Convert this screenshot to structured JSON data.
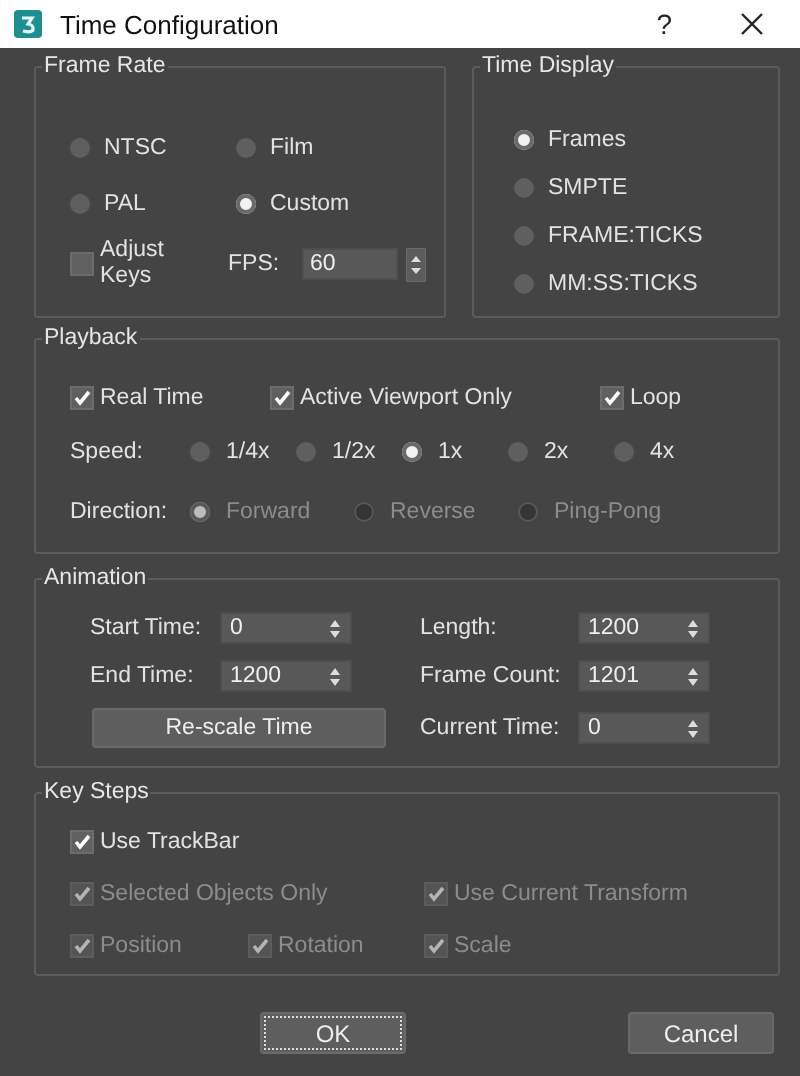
{
  "window": {
    "title": "Time Configuration",
    "help": "?"
  },
  "frame_rate": {
    "title": "Frame Rate",
    "options": [
      {
        "label": "NTSC",
        "selected": false
      },
      {
        "label": "Film",
        "selected": false
      },
      {
        "label": "PAL",
        "selected": false
      },
      {
        "label": "Custom",
        "selected": true
      }
    ],
    "adjust_keys": {
      "label": "Adjust Keys",
      "checked": false
    },
    "fps": {
      "label": "FPS:",
      "value": "60"
    }
  },
  "time_display": {
    "title": "Time Display",
    "options": [
      {
        "label": "Frames",
        "selected": true
      },
      {
        "label": "SMPTE",
        "selected": false
      },
      {
        "label": "FRAME:TICKS",
        "selected": false
      },
      {
        "label": "MM:SS:TICKS",
        "selected": false
      }
    ]
  },
  "playback": {
    "title": "Playback",
    "checks": [
      {
        "label": "Real Time",
        "checked": true
      },
      {
        "label": "Active Viewport Only",
        "checked": true
      },
      {
        "label": "Loop",
        "checked": true
      }
    ],
    "speed": {
      "label": "Speed:",
      "options": [
        {
          "label": "1/4x",
          "selected": false,
          "disabled": false
        },
        {
          "label": "1/2x",
          "selected": false,
          "disabled": false
        },
        {
          "label": "1x",
          "selected": true,
          "disabled": false
        },
        {
          "label": "2x",
          "selected": false,
          "disabled": false
        },
        {
          "label": "4x",
          "selected": false,
          "disabled": false
        }
      ]
    },
    "direction": {
      "label": "Direction:",
      "options": [
        {
          "label": "Forward",
          "selected": true,
          "disabled": true
        },
        {
          "label": "Reverse",
          "selected": false,
          "disabled": true
        },
        {
          "label": "Ping-Pong",
          "selected": false,
          "disabled": true
        }
      ]
    }
  },
  "animation": {
    "title": "Animation",
    "fields": [
      {
        "label": "Start Time:",
        "value": "0"
      },
      {
        "label": "Length:",
        "value": "1200"
      },
      {
        "label": "End Time:",
        "value": "1200"
      },
      {
        "label": "Frame Count:",
        "value": "1201"
      },
      {
        "label": "Current Time:",
        "value": "0"
      }
    ],
    "rescale": "Re-scale Time"
  },
  "key_steps": {
    "title": "Key Steps",
    "use_trackbar": {
      "label": "Use TrackBar",
      "checked": true,
      "disabled": false
    },
    "options": [
      {
        "label": "Selected Objects Only",
        "checked": true,
        "disabled": true
      },
      {
        "label": "Use Current Transform",
        "checked": true,
        "disabled": true
      },
      {
        "label": "Position",
        "checked": true,
        "disabled": true
      },
      {
        "label": "Rotation",
        "checked": true,
        "disabled": true
      },
      {
        "label": "Scale",
        "checked": true,
        "disabled": true
      }
    ]
  },
  "buttons": [
    {
      "label": "OK",
      "focused": true
    },
    {
      "label": "Cancel",
      "focused": false
    }
  ]
}
